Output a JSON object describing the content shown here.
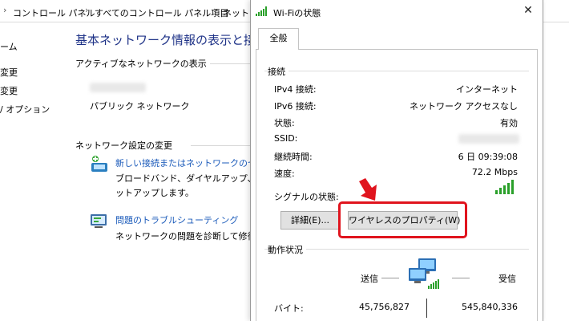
{
  "control_panel": {
    "breadcrumb": [
      "コントロール パネル",
      "すべてのコントロール パネル項目",
      "ネットワ"
    ],
    "sidebar": [
      "ーム",
      "変更",
      "変更",
      "/ オプション"
    ],
    "title": "基本ネットワーク情報の表示と接続の",
    "active_networks_heading": "アクティブなネットワークの表示",
    "network_type": "パブリック ネットワーク",
    "change_settings_heading": "ネットワーク設定の変更",
    "new_connection_link": "新しい接続またはネットワークのセットア",
    "new_connection_desc_1": "ブロードバンド、ダイヤルアップ、または V",
    "new_connection_desc_2": "ットアップします。",
    "troubleshoot_link": "問題のトラブルシューティング",
    "troubleshoot_desc": "ネットワークの問題を診断して修復しま"
  },
  "dialog": {
    "title": "Wi-Fiの状態",
    "close_icon": "close-icon",
    "tab_general": "全般",
    "connection_group": "接続",
    "rows": [
      {
        "label": "IPv4 接続:",
        "value": "インターネット"
      },
      {
        "label": "IPv6 接続:",
        "value": "ネットワーク アクセスなし"
      },
      {
        "label": "状態:",
        "value": "有効"
      },
      {
        "label": "SSID:",
        "value": ""
      },
      {
        "label": "継続時間:",
        "value": "6 日 09:39:08"
      },
      {
        "label": "速度:",
        "value": "72.2 Mbps"
      }
    ],
    "signal_label": "シグナルの状態:",
    "details_button": "詳細(E)...",
    "properties_button": "ワイヤレスのプロパティ(W)",
    "activity_group": "動作状況",
    "sent_label": "送信",
    "received_label": "受信",
    "bytes_label": "バイト:",
    "bytes_sent": "45,756,827",
    "bytes_received": "545,840,336"
  },
  "colors": {
    "link": "#1a5aba",
    "title_blue": "#1e3287",
    "highlight_red": "#e0141e",
    "signal_green": "#2aa02a"
  }
}
